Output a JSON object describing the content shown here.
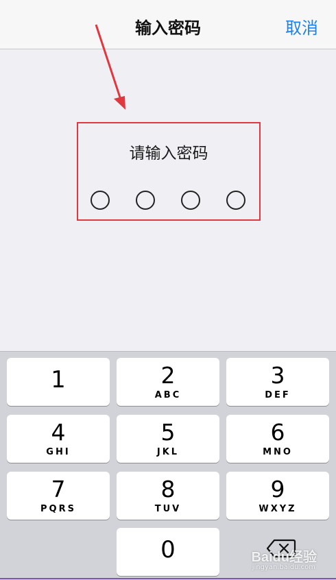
{
  "navbar": {
    "title": "输入密码",
    "cancel_label": "取消"
  },
  "pin_entry": {
    "prompt": "请输入密码",
    "digits_total": 4,
    "digits_entered": 0
  },
  "keypad": {
    "keys": [
      {
        "num": "1",
        "letters": ""
      },
      {
        "num": "2",
        "letters": "ABC"
      },
      {
        "num": "3",
        "letters": "DEF"
      },
      {
        "num": "4",
        "letters": "GHI"
      },
      {
        "num": "5",
        "letters": "JKL"
      },
      {
        "num": "6",
        "letters": "MNO"
      },
      {
        "num": "7",
        "letters": "PQRS"
      },
      {
        "num": "8",
        "letters": "TUV"
      },
      {
        "num": "9",
        "letters": "WXYZ"
      },
      {
        "num": "0",
        "letters": ""
      }
    ],
    "delete_icon": "backspace-icon"
  },
  "watermark": {
    "brand": "Baidu经验",
    "url": "jingyan.baidu.com"
  },
  "colors": {
    "accent": "#1a82f0",
    "annotation": "#e0383e",
    "keypad_bg": "#d1d3d9"
  }
}
